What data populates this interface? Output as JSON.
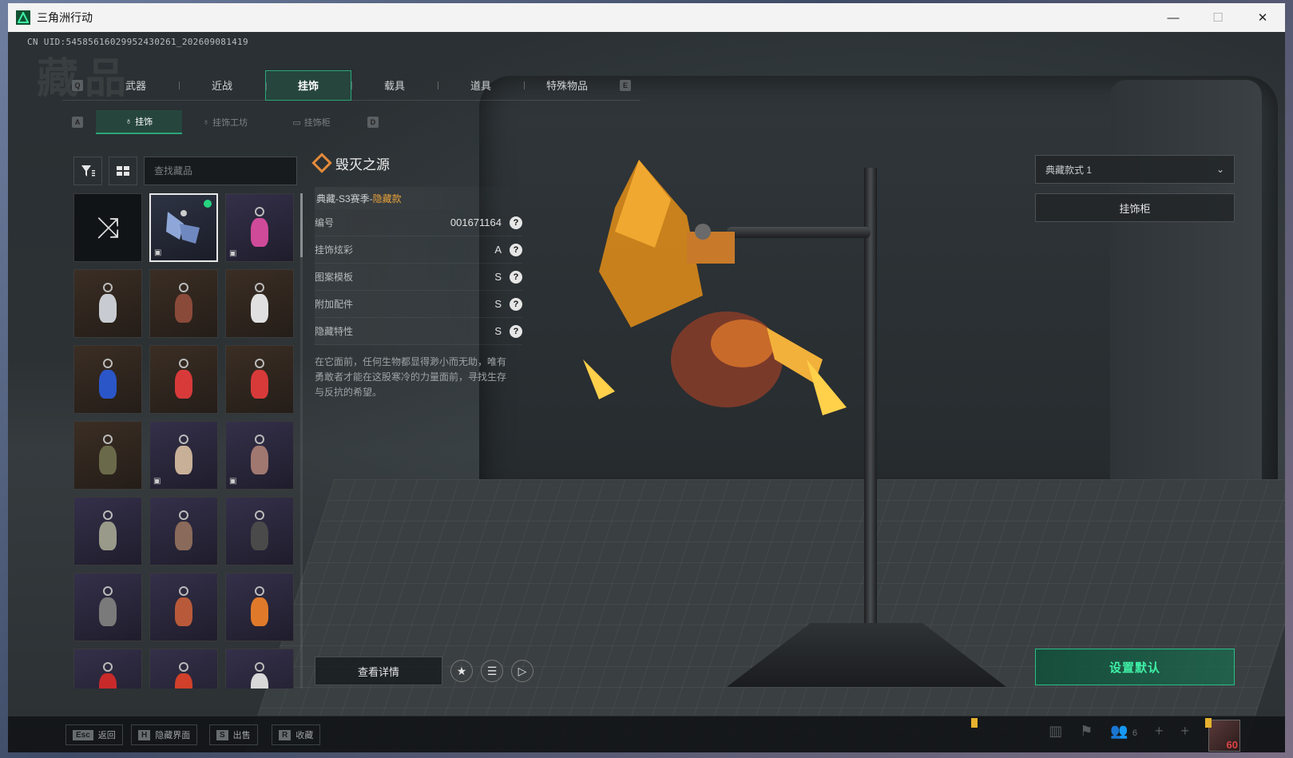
{
  "window": {
    "title": "三角洲行动",
    "minimize_icon": "—",
    "maximize_icon": "☐",
    "close_icon": "✕"
  },
  "uid": "CN UID:5458561602995243026​1_202609081419",
  "bg_word": "藏品",
  "tabs": {
    "key_left": "Q",
    "key_right": "E",
    "items": [
      {
        "label": "武器"
      },
      {
        "label": "近战"
      },
      {
        "label": "挂饰"
      },
      {
        "label": "载具"
      },
      {
        "label": "道具"
      },
      {
        "label": "特殊物品"
      }
    ],
    "active_index": 2
  },
  "subtabs": {
    "key_left": "A",
    "key_right": "D",
    "items": [
      {
        "label": "挂饰"
      },
      {
        "label": "挂饰工坊"
      },
      {
        "label": "挂饰柜"
      }
    ],
    "active_index": 0
  },
  "toolbar": {
    "filter_icon": "filter-icon",
    "view_icon": "grid-view-icon",
    "search_placeholder": "查找藏品"
  },
  "grid": {
    "shuffle_icon": "⤨",
    "items": [
      {
        "type": "shuffle",
        "bg": "black"
      },
      {
        "type": "dragon",
        "bg": "selected",
        "dot": true,
        "mini": "▣"
      },
      {
        "type": "charm",
        "bg": "purple",
        "color": "#d04a9a",
        "mini": "▣"
      },
      {
        "type": "charm",
        "bg": "brown",
        "color": "#c8ccd2"
      },
      {
        "type": "charm",
        "bg": "brown",
        "color": "#8a4a3a"
      },
      {
        "type": "charm",
        "bg": "brown",
        "color": "#e0e0e0"
      },
      {
        "type": "charm",
        "bg": "brown",
        "color": "#2b56c8"
      },
      {
        "type": "charm",
        "bg": "brown",
        "color": "#d83a3a"
      },
      {
        "type": "charm",
        "bg": "brown",
        "color": "#d83a3a"
      },
      {
        "type": "charm",
        "bg": "brown",
        "color": "#6a6a4a"
      },
      {
        "type": "charm",
        "bg": "purple",
        "color": "#c8b098",
        "mini": "▣"
      },
      {
        "type": "charm",
        "bg": "purple",
        "color": "#a07870",
        "mini": "▣"
      },
      {
        "type": "charm",
        "bg": "purple",
        "color": "#9a9a8a"
      },
      {
        "type": "charm",
        "bg": "purple",
        "color": "#8a6a5a"
      },
      {
        "type": "charm",
        "bg": "purple",
        "color": "#4a4a4a"
      },
      {
        "type": "charm",
        "bg": "purple",
        "color": "#7a7a7a"
      },
      {
        "type": "charm",
        "bg": "purple",
        "color": "#b85a3a"
      },
      {
        "type": "charm",
        "bg": "purple",
        "color": "#e07a2a"
      },
      {
        "type": "charm",
        "bg": "purple",
        "color": "#c82a2a"
      },
      {
        "type": "charm",
        "bg": "purple",
        "color": "#d0402a"
      },
      {
        "type": "charm",
        "bg": "purple",
        "color": "#d8d8d8"
      }
    ]
  },
  "detail": {
    "name": "毁灭之源",
    "series_prefix": "典藏-S3赛季-",
    "series_hidden": "隐藏款",
    "rows": [
      {
        "label": "编号",
        "value": "001671164"
      },
      {
        "label": "挂饰炫彩",
        "value": "A"
      },
      {
        "label": "图案模板",
        "value": "S"
      },
      {
        "label": "附加配件",
        "value": "S"
      },
      {
        "label": "隐藏特性",
        "value": "S"
      }
    ],
    "help_icon": "?",
    "description": "在它面前，任何生物都显得渺小而无助，唯有勇敢者才能在这股寒冷的力量面前，寻找生存与反抗的希望。"
  },
  "actions": {
    "view_detail": "查看详情",
    "star_icon": "★",
    "list_icon": "☰",
    "play_icon": "▷"
  },
  "right_panel": {
    "style_select": "典藏款式 1",
    "chevron_icon": "⌄",
    "cabinet_button": "挂饰柜",
    "set_default": "设置默认"
  },
  "bottom_bar": {
    "hints": [
      {
        "key": "Esc",
        "label": "返回"
      },
      {
        "key": "H",
        "label": "隐藏界面"
      },
      {
        "key": "S",
        "label": "出售"
      },
      {
        "key": "R",
        "label": "收藏"
      }
    ],
    "stats_icon": "▥",
    "flag_icon": "⚑",
    "friends_icon": "👥",
    "friends_count": "6",
    "add1": "+",
    "add2": "+",
    "level": "60"
  },
  "colors": {
    "accent": "#2aa57a",
    "hidden": "#e6a23c",
    "rarity_dot": "#27d47f"
  }
}
